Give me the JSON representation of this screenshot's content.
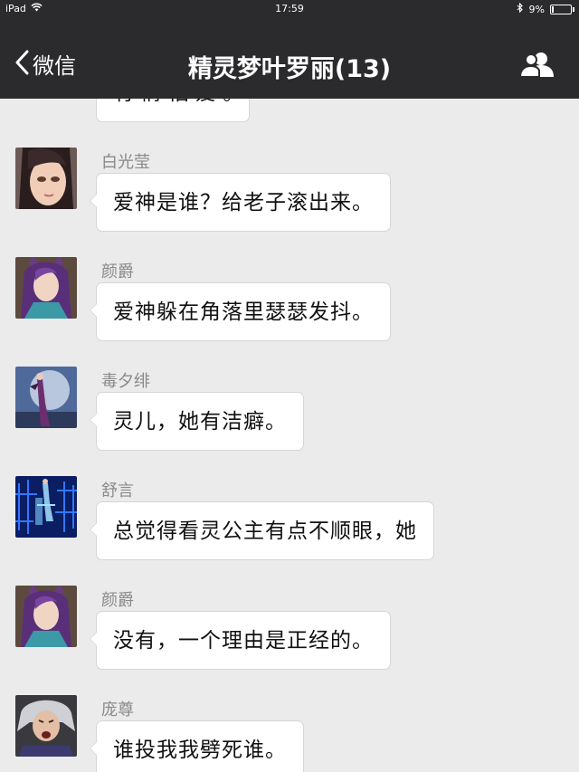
{
  "status_bar": {
    "device": "iPad",
    "time": "17:59",
    "battery": "9%",
    "battery_level": 0.09
  },
  "nav": {
    "back_label": "微信",
    "title": "精灵梦叶罗丽(13)"
  },
  "partial_message": {
    "text": "有 情 怕 爱 。"
  },
  "messages": [
    {
      "sender": "白光莹",
      "text": "爱神是谁？给老子滚出来。",
      "avatar": "white-haired-girl-avatar"
    },
    {
      "sender": "颜爵",
      "text": "爱神躲在角落里瑟瑟发抖。",
      "avatar": "purple-hair-avatar"
    },
    {
      "sender": "毒夕绯",
      "text": "灵儿，她有洁癖。",
      "avatar": "moon-figure-avatar"
    },
    {
      "sender": "舒言",
      "text": "总觉得看灵公主有点不顺眼，她",
      "avatar": "blue-grid-avatar"
    },
    {
      "sender": "颜爵",
      "text": "没有，一个理由是正经的。",
      "avatar": "purple-hair-avatar"
    },
    {
      "sender": "庞尊",
      "text": "谁投我我劈死谁。",
      "avatar": "silver-hair-avatar"
    }
  ],
  "colors": {
    "nav_background": "#2b2b2d",
    "chat_background": "#ebebeb",
    "bubble_background": "#ffffff",
    "sender_name": "#8a8a8a"
  }
}
